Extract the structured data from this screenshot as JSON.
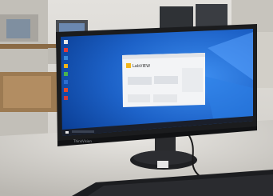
{
  "scene": {
    "description_hidden": "",
    "monitor_brand": "ThinkVision",
    "app_title": "LabVIEW",
    "colors": {
      "wall": "#d9d6cf",
      "desk": "#c9c6c0",
      "bezel": "#1b1c1e",
      "desktop_blue": "#1d62c8",
      "desktop_blue_dark": "#0b3f96",
      "taskbar": "#1a1f2b",
      "labview_yellow": "#f2b61c"
    }
  }
}
